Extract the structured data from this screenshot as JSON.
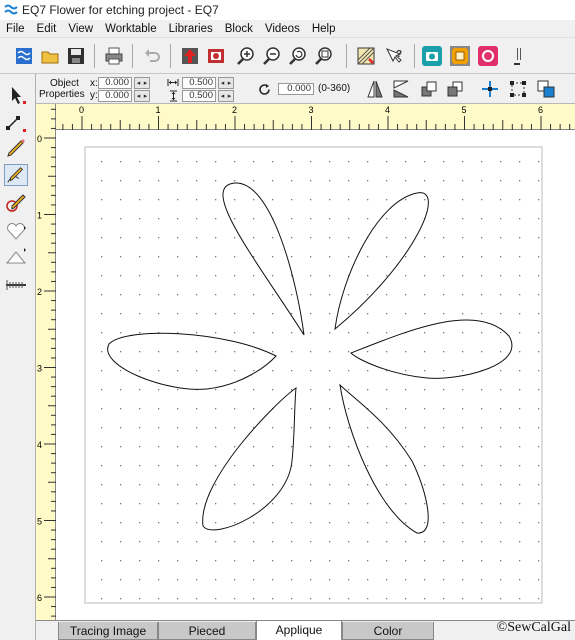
{
  "window": {
    "title": "EQ7 Flower for etching project - EQ7"
  },
  "menu": [
    "File",
    "Edit",
    "View",
    "Worktable",
    "Libraries",
    "Block",
    "Videos",
    "Help"
  ],
  "toolbar": {
    "icons": [
      "new-sketch-icon",
      "open-icon",
      "save-icon",
      "print-icon",
      "undo-icon",
      "add-to-sketchbook-icon",
      "view-sketchbook-icon",
      "zoom-in-icon",
      "zoom-out-icon",
      "refresh-zoom-icon",
      "fit-to-worktable-icon",
      "block-worktable-icon",
      "help-icon",
      "camera-icon",
      "applique-layer-icon",
      "pieced-layer-icon",
      "more-icon"
    ]
  },
  "object_properties": {
    "label_line1": "Object",
    "label_line2": "Properties",
    "x_label": "x:",
    "x_value": "0.000",
    "y_label": "y:",
    "y_value": "0.000",
    "width_value": "0.500",
    "height_value": "0.500",
    "rotation_value": "0.000",
    "rotation_range": "(0-360)"
  },
  "rulers": {
    "top_labels": [
      "0",
      "1",
      "2",
      "3",
      "4",
      "5",
      "6"
    ],
    "left_labels": [
      "0",
      "1",
      "2",
      "3",
      "4",
      "5",
      "6"
    ]
  },
  "tabs": [
    {
      "label": "Tracing Image",
      "active": false
    },
    {
      "label": "Pieced",
      "active": false
    },
    {
      "label": "Applique",
      "active": true
    },
    {
      "label": "Color",
      "active": false
    }
  ],
  "watermark": "©SewCalGal",
  "colors": {
    "accent_teal": "#1aa0a8",
    "accent_orange": "#f0a000",
    "accent_pink": "#e0306a",
    "ruler_bg": "#fffbc8"
  }
}
